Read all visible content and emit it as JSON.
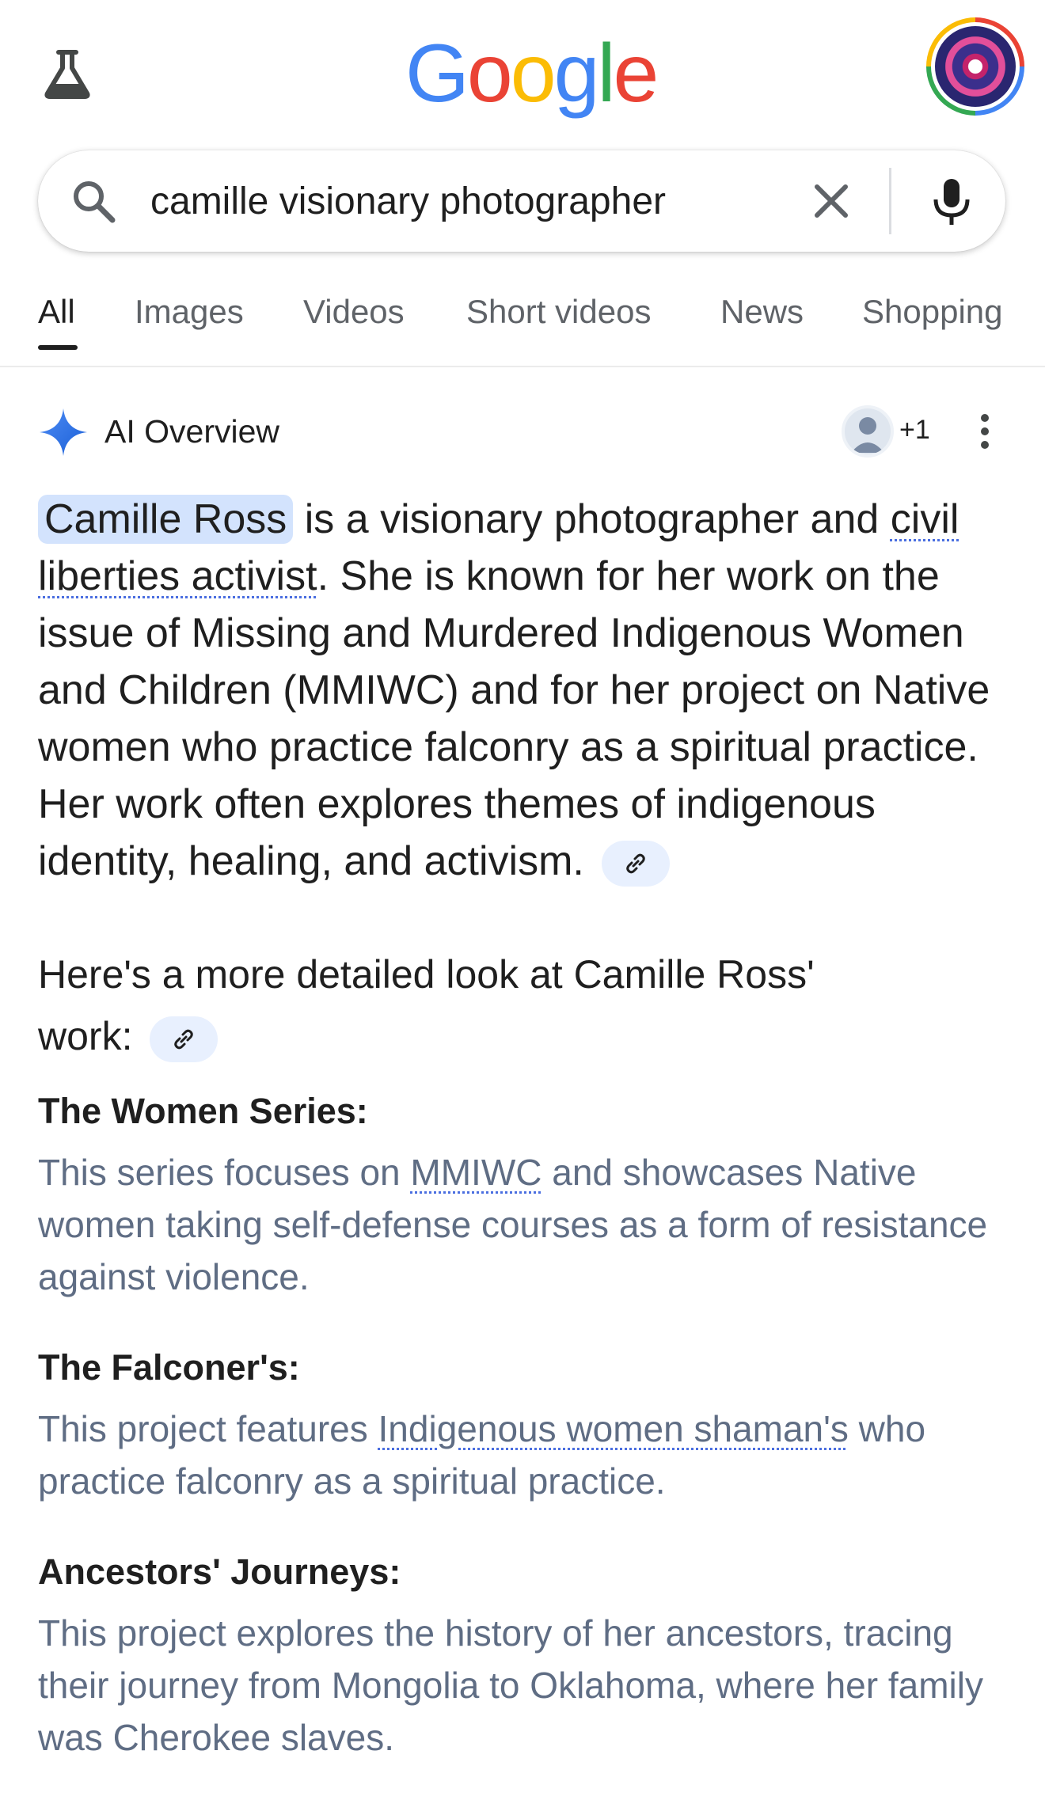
{
  "header": {
    "logo_letters": [
      {
        "char": "G",
        "color": "#4285f4"
      },
      {
        "char": "o",
        "color": "#ea4335"
      },
      {
        "char": "o",
        "color": "#fbbc05"
      },
      {
        "char": "g",
        "color": "#4285f4"
      },
      {
        "char": "l",
        "color": "#34a853"
      },
      {
        "char": "e",
        "color": "#ea4335"
      }
    ],
    "labs_icon": "flask-icon",
    "avatar_icon": "profile-avatar"
  },
  "search": {
    "query": "camille visionary photographer",
    "clear_icon": "close-icon",
    "mic_icon": "microphone-icon"
  },
  "tabs": [
    "All",
    "Images",
    "Videos",
    "Short videos",
    "News",
    "Shopping"
  ],
  "ai_overview": {
    "title": "AI Overview",
    "contributors": "+1",
    "summary": {
      "entity": "Camille Ross",
      "part1": " is a visionary photographer and ",
      "link1": "civil liberties activist",
      "part2": ". She is known for her work on the issue of Missing and Murdered Indigenous Women and Children (MMIWC) and for her project on Native women who practice falconry as a spiritual practice. Her work often explores themes of indigenous identity, healing, and activism."
    },
    "subheading_a": "Here's a more detailed look at Camille Ross'",
    "subheading_b": "work:",
    "items": [
      {
        "title": "The Women Series:",
        "before": "This series focuses on ",
        "link": "MMIWC",
        "after": " and showcases Native women taking self-defense courses as a form of resistance against violence."
      },
      {
        "title": "The Falconer's:",
        "before": "This project features ",
        "link": "Indigenous women shaman's",
        "after": " who practice falconry as a spiritual practice."
      },
      {
        "title": "Ancestors' Journeys:",
        "before": "This project explores the history of her ancestors, tracing their journey from Mongolia to Oklahoma, where her family was Cherokee slaves.",
        "link": "",
        "after": ""
      }
    ]
  },
  "colors": {
    "accent_blue": "#4285f4",
    "entity_chip": "#d3e3fd",
    "link_chip": "#e8f0fe",
    "body_muted": "#5f6d84"
  }
}
